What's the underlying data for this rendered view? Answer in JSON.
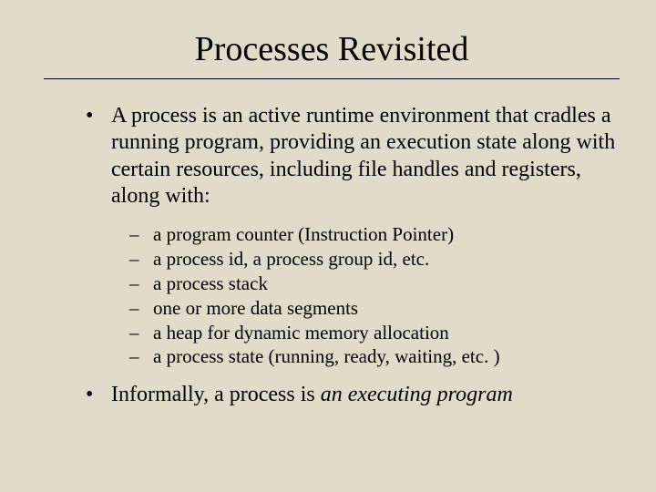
{
  "title": "Processes Revisited",
  "bullets": {
    "b1": "A process is an active runtime environment that cradles a running program, providing an execution state along with certain resources, including file handles and registers, along with:",
    "sub": {
      "s1": "a program counter (Instruction Pointer)",
      "s2": "a process id, a process group id, etc.",
      "s3": "a process stack",
      "s4": "one or more data segments",
      "s5": "a heap for dynamic memory allocation",
      "s6": "a process state (running, ready, waiting, etc. )"
    },
    "b2_prefix": "Informally, a process is ",
    "b2_em": "an executing program"
  }
}
